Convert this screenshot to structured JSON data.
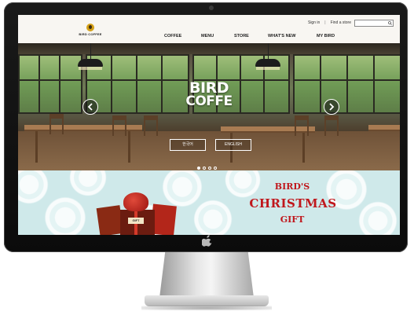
{
  "site": {
    "logo_text": "BIRD COFFEE",
    "top_links": {
      "sign_in": "Sign in",
      "separator": "|",
      "find_store": "Find a store"
    },
    "nav": [
      {
        "label": "COFFEE"
      },
      {
        "label": "MENU"
      },
      {
        "label": "STORE"
      },
      {
        "label": "WHAT'S NEW"
      },
      {
        "label": "MY BIRD"
      }
    ],
    "search": {
      "placeholder": ""
    }
  },
  "hero": {
    "title_line1": "BIRD",
    "title_line2": "COFFE",
    "buttons": [
      {
        "label": "한국어"
      },
      {
        "label": "ENGLISH"
      }
    ],
    "slides": {
      "count": 4,
      "active_index": 0
    }
  },
  "promo": {
    "line1": "BIRD'S",
    "line2": "CHRISTMAS",
    "line3": "GIFT",
    "gift_label": "GIFT"
  },
  "colors": {
    "promo_red": "#c0171c",
    "promo_bg": "#cfe9ea",
    "logo_gold": "#d4a017"
  },
  "icons": [
    "search-icon",
    "chevron-left-icon",
    "chevron-right-icon",
    "apple-logo-icon"
  ]
}
